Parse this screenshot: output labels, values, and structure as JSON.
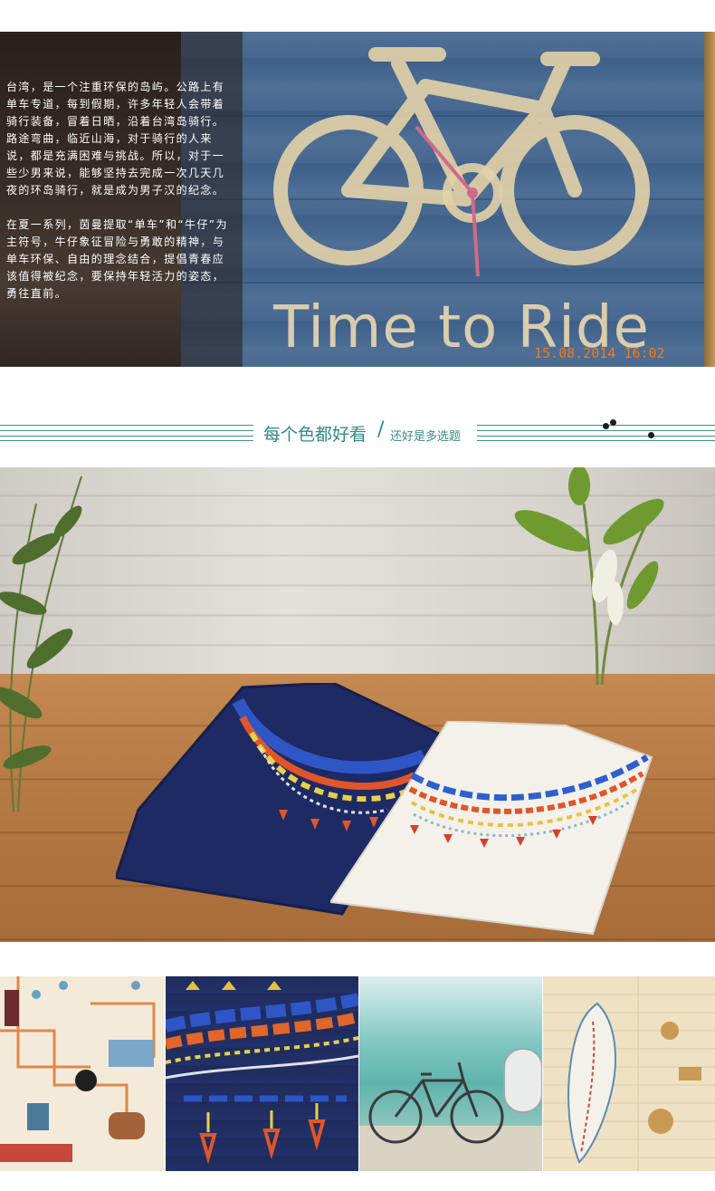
{
  "hero": {
    "sign_title": "Time to Ride",
    "photo_stamp": "15.08.2014 16:02",
    "paragraphs": [
      "台湾，是一个注重环保的岛屿。公路上有单车专道，每到假期，许多年轻人会带着骑行装备，冒着日晒，沿着台湾岛骑行。路途弯曲，临近山海，对于骑行的人来说，都是充满困难与挑战。所以，对于一些少男来说，能够坚持去完成一次几天几夜的环岛骑行，就是成为男子汉的纪念。",
      "在夏一系列，茵曼提取“单车”和“牛仔”为主符号，牛仔象征冒险与勇敢的精神，与单车环保、自由的理念结合，提倡青春应该值得被纪念，要保持年轻活力的姿态，勇往直前。"
    ]
  },
  "section": {
    "heading_main": "每个色都好看",
    "heading_slash": "/",
    "heading_sub": "还好是多选题"
  },
  "colors": {
    "accent": "#2f8a86",
    "stamp": "#f07a1a",
    "navy_shirt": "#1e2a63",
    "white_shirt": "#f4f1ea"
  },
  "icons": {
    "music_notes": "music-notes-icon"
  }
}
